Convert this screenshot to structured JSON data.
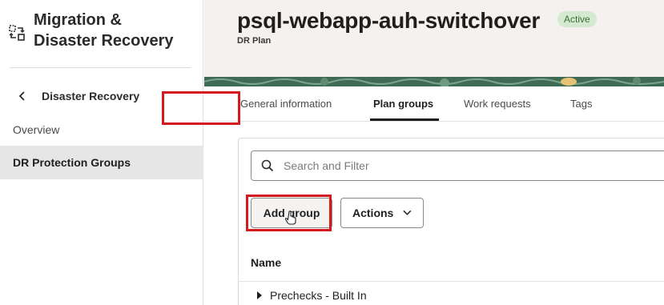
{
  "sidebar": {
    "app_title": "Migration & Disaster Recovery",
    "back_label": "Disaster Recovery",
    "items": [
      {
        "label": "Overview",
        "selected": false
      },
      {
        "label": "DR Protection Groups",
        "selected": true
      }
    ]
  },
  "header": {
    "title": "psql-webapp-auh-switchover",
    "status_badge": "Active",
    "subtitle": "DR Plan"
  },
  "tabs": [
    {
      "label": "General information",
      "active": false
    },
    {
      "label": "Plan groups",
      "active": true
    },
    {
      "label": "Work requests",
      "active": false
    },
    {
      "label": "Tags",
      "active": false
    }
  ],
  "toolbar": {
    "search_placeholder": "Search and Filter",
    "add_group_label": "Add group",
    "actions_label": "Actions"
  },
  "table": {
    "column_header": "Name",
    "rows": [
      {
        "name": "Prechecks - Built In",
        "expanded": false
      }
    ]
  },
  "colors": {
    "highlight": "#d41a1f",
    "badge_bg": "#d4ead0",
    "badge_text": "#3c6d37",
    "header_bg": "#f5f1ee"
  },
  "icons": [
    "migration-app-icon",
    "chevron-left-icon",
    "search-icon",
    "chevron-down-icon",
    "caret-right-icon",
    "hand-pointer-cursor-icon"
  ]
}
